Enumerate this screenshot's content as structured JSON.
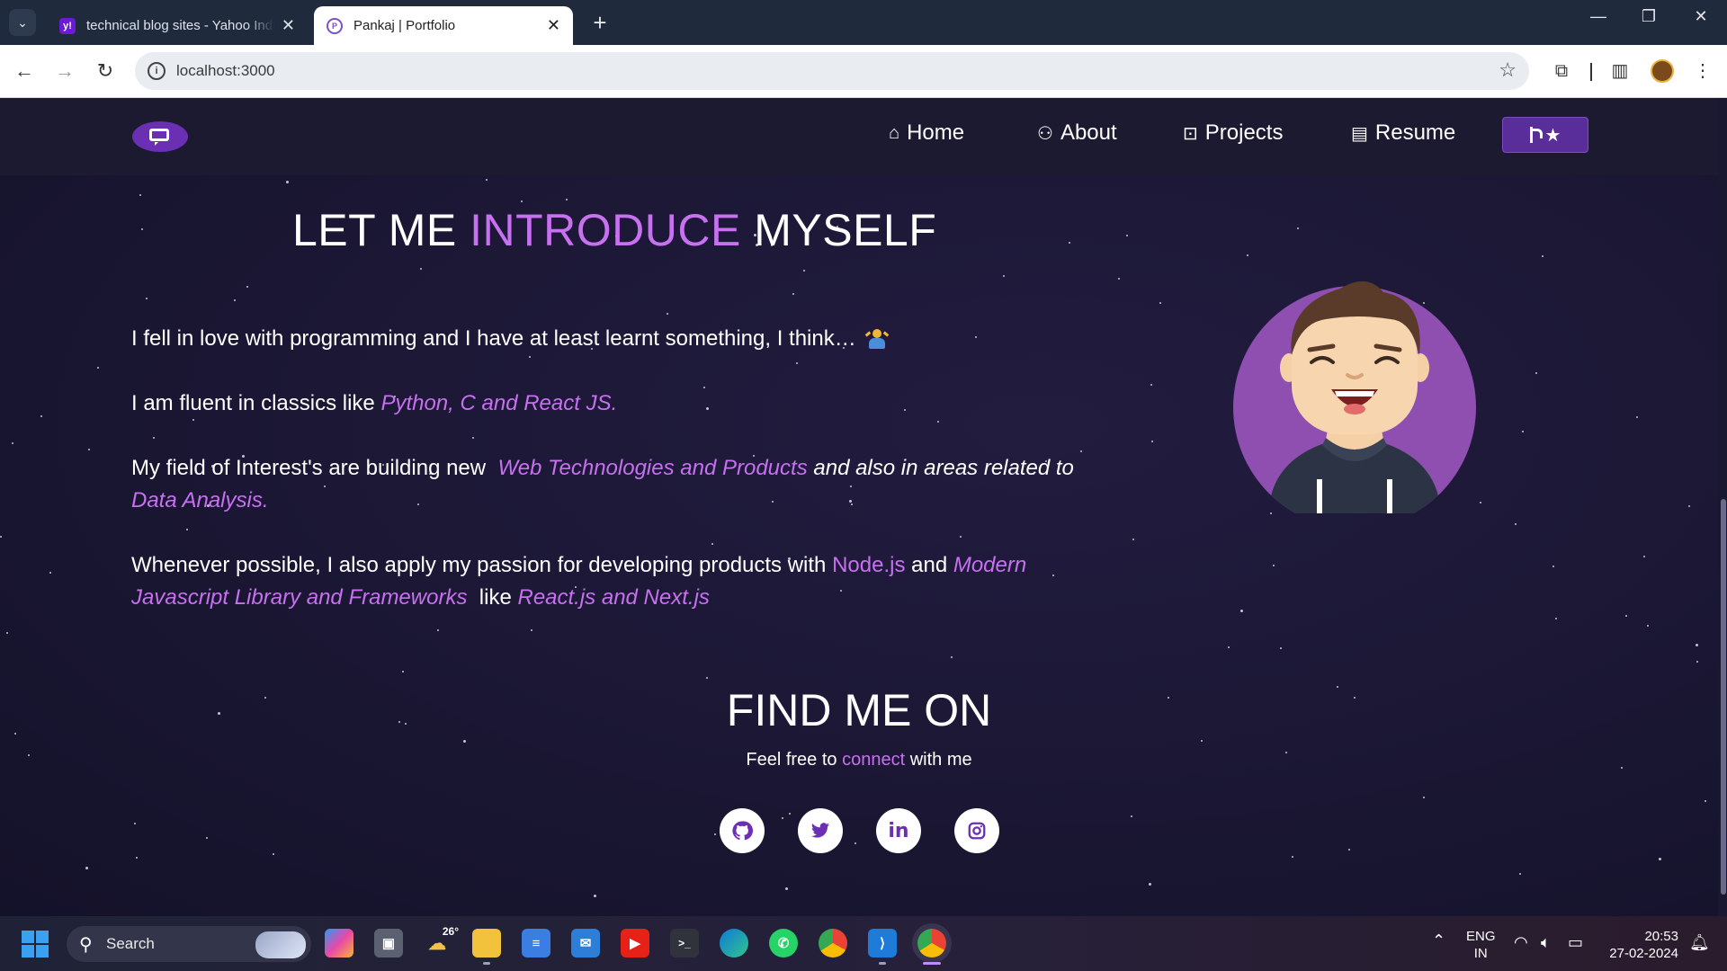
{
  "browser": {
    "tabs": [
      {
        "title": "technical blog sites - Yahoo India Search Results",
        "favicon": "y!",
        "active": false
      },
      {
        "title": "Pankaj | Portfolio",
        "favicon": "P",
        "active": true
      }
    ],
    "new_tab": "+",
    "window_controls": {
      "minimize": "—",
      "restore": "❐",
      "close": "✕"
    },
    "url": "localhost:3000"
  },
  "site": {
    "nav": {
      "home": "Home",
      "about": "About",
      "projects": "Projects",
      "resume": "Resume"
    },
    "intro": {
      "title_pre": "LET ME",
      "title_highlight": "INTRODUCE",
      "title_post": "MYSELF",
      "p1": "I fell in love with programming and I have at least learnt something, I think…",
      "p2_pre": "I am fluent in classics like",
      "p2_langs": "Python, C and React JS.",
      "p3_pre": "My field of Interest's are building new",
      "p3_web": "Web Technologies and Products",
      "p3_mid": "and also in areas related to",
      "p3_data": "Data Analysis.",
      "p4_pre": "Whenever possible, I also apply my passion for developing products with",
      "p4_node": "Node.js",
      "p4_and": "and",
      "p4_modern": "Modern Javascript Library and Frameworks",
      "p4_like": "like",
      "p4_react": "React.js and Next.js"
    },
    "find": {
      "title": "FIND ME ON",
      "sub_pre": "Feel free to",
      "sub_link": "connect",
      "sub_post": "with me"
    },
    "social": [
      "github",
      "twitter",
      "linkedin",
      "instagram"
    ]
  },
  "taskbar": {
    "search_label": "Search",
    "weather_temp": "26°",
    "lang_line1": "ENG",
    "lang_line2": "IN",
    "time": "20:53",
    "date": "27-02-2024"
  },
  "colors": {
    "accent": "#c770f0",
    "navbar_bg": "#1b1a30",
    "page_bg": "#1c1a35",
    "fork_button": "#5a2e9a"
  }
}
